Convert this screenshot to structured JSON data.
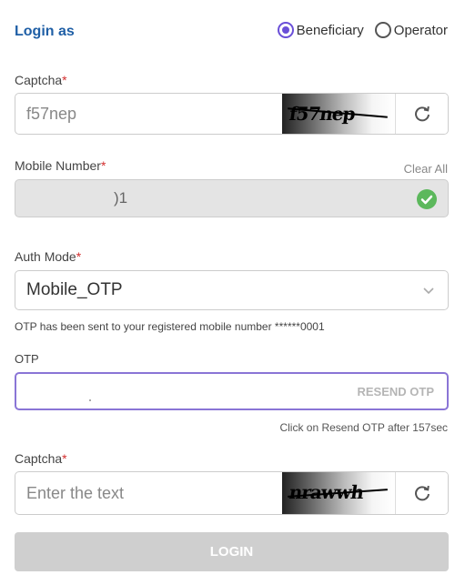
{
  "login_as": {
    "title": "Login as",
    "options": [
      {
        "label": "Beneficiary",
        "selected": true
      },
      {
        "label": "Operator",
        "selected": false
      }
    ]
  },
  "captcha1": {
    "label": "Captcha",
    "required_mark": "*",
    "value": "f57nep",
    "image_text": "f57nep"
  },
  "mobile": {
    "label": "Mobile Number",
    "required_mark": "*",
    "clear_all": "Clear All",
    "value": ")1",
    "status_icon": "check-circle-icon"
  },
  "auth_mode": {
    "label": "Auth Mode",
    "required_mark": "*",
    "selected": "Mobile_OTP"
  },
  "otp_message": "OTP has been sent to your registered mobile number ******0001",
  "otp": {
    "label": "OTP",
    "resend_label": "RESEND OTP",
    "resend_note": "Click on Resend OTP after 157sec"
  },
  "captcha2": {
    "label": "Captcha",
    "required_mark": "*",
    "placeholder": "Enter the text",
    "image_text": "nrawwh"
  },
  "login_button": "LOGIN",
  "colors": {
    "accent": "#6a4fd8",
    "title": "#1f5fa6",
    "required": "#d32f2f",
    "success": "#5cb85c"
  }
}
